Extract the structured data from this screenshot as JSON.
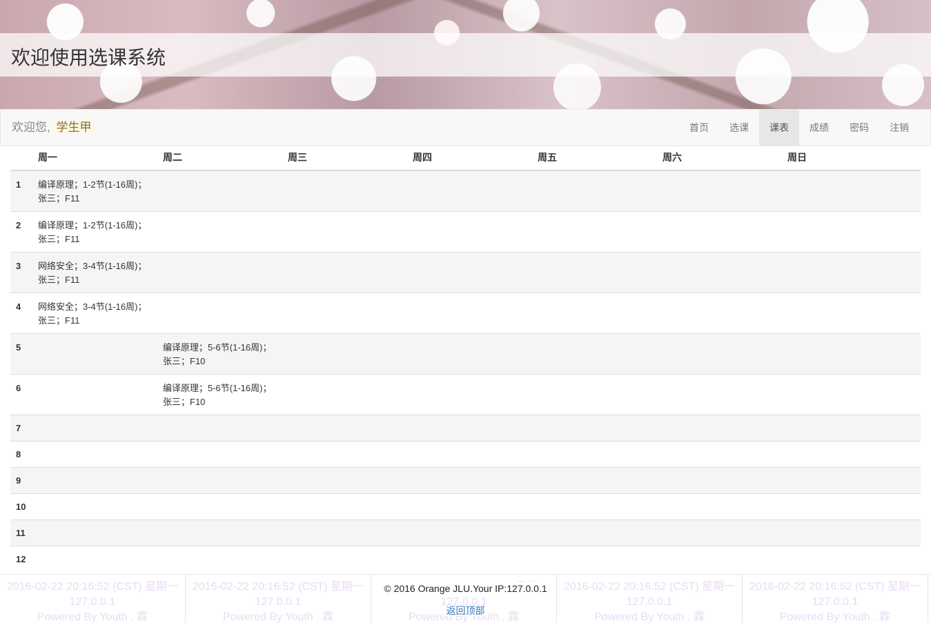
{
  "header": {
    "title": "欢迎使用选课系统"
  },
  "navbar": {
    "welcome_prefix": "欢迎您,",
    "username": "学生甲",
    "items": [
      {
        "label": "首页",
        "active": false
      },
      {
        "label": "选课",
        "active": false
      },
      {
        "label": "课表",
        "active": true
      },
      {
        "label": "成绩",
        "active": false
      },
      {
        "label": "密码",
        "active": false
      },
      {
        "label": "注销",
        "active": false
      }
    ]
  },
  "schedule": {
    "days": [
      "周一",
      "周二",
      "周三",
      "周四",
      "周五",
      "周六",
      "周日"
    ],
    "rows": [
      {
        "period": "1",
        "cells": [
          "编译原理；1-2节(1-16周)；张三；F11",
          "",
          "",
          "",
          "",
          "",
          ""
        ]
      },
      {
        "period": "2",
        "cells": [
          "编译原理；1-2节(1-16周)；张三；F11",
          "",
          "",
          "",
          "",
          "",
          ""
        ]
      },
      {
        "period": "3",
        "cells": [
          "网络安全；3-4节(1-16周)；张三；F11",
          "",
          "",
          "",
          "",
          "",
          ""
        ]
      },
      {
        "period": "4",
        "cells": [
          "网络安全；3-4节(1-16周)；张三；F11",
          "",
          "",
          "",
          "",
          "",
          ""
        ]
      },
      {
        "period": "5",
        "cells": [
          "",
          "编译原理；5-6节(1-16周)；张三；F10",
          "",
          "",
          "",
          "",
          ""
        ]
      },
      {
        "period": "6",
        "cells": [
          "",
          "编译原理；5-6节(1-16周)；张三；F10",
          "",
          "",
          "",
          "",
          ""
        ]
      },
      {
        "period": "7",
        "cells": [
          "",
          "",
          "",
          "",
          "",
          "",
          ""
        ]
      },
      {
        "period": "8",
        "cells": [
          "",
          "",
          "",
          "",
          "",
          "",
          ""
        ]
      },
      {
        "period": "9",
        "cells": [
          "",
          "",
          "",
          "",
          "",
          "",
          ""
        ]
      },
      {
        "period": "10",
        "cells": [
          "",
          "",
          "",
          "",
          "",
          "",
          ""
        ]
      },
      {
        "period": "11",
        "cells": [
          "",
          "",
          "",
          "",
          "",
          "",
          ""
        ]
      },
      {
        "period": "12",
        "cells": [
          "",
          "",
          "",
          "",
          "",
          "",
          ""
        ]
      }
    ]
  },
  "footer": {
    "copyright": "© 2016 Orange JLU.Your IP:127.0.0.1",
    "back_to_top": "返回顶部",
    "watermark": {
      "line1": "2016-02-22 20:16:52 (CST) 星期一",
      "line2": "127.0.0.1",
      "line3": "Powered By Youth . 霖"
    }
  }
}
